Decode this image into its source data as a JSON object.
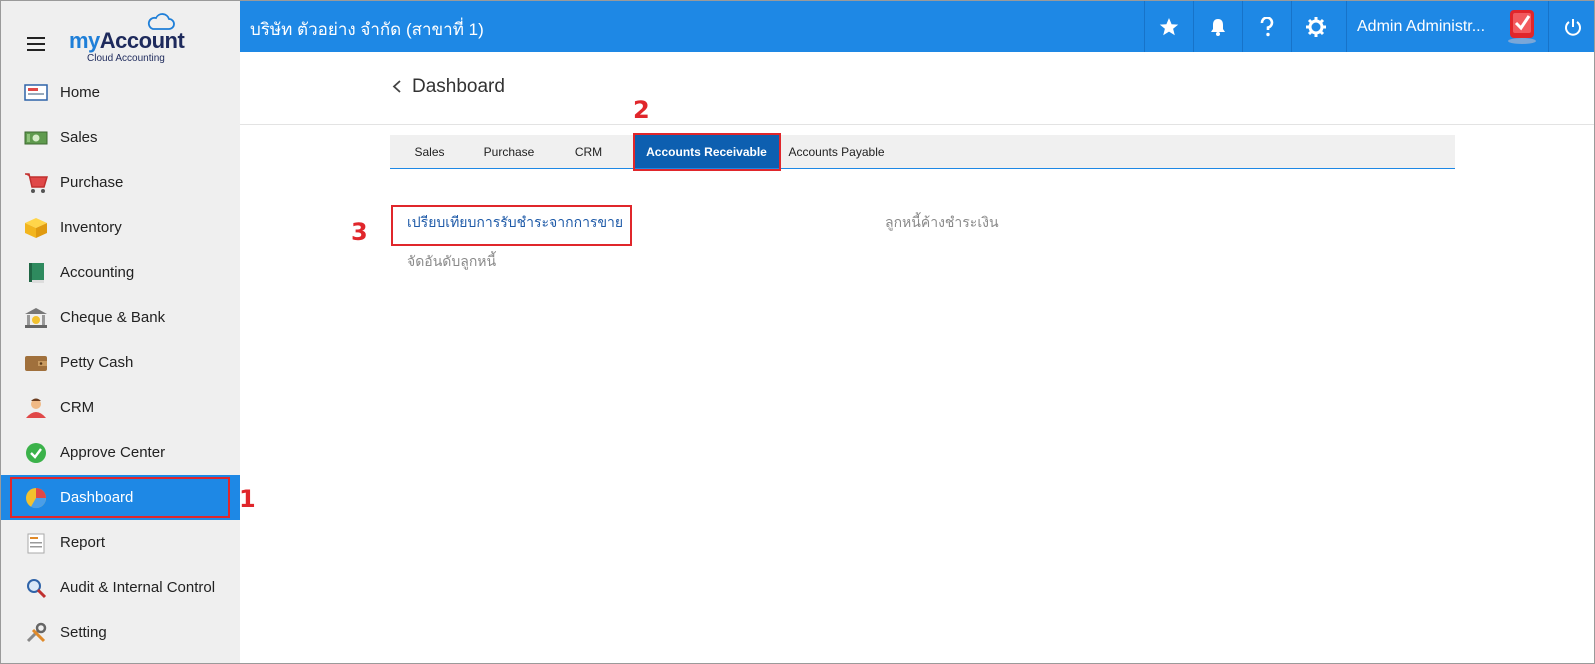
{
  "app": {
    "logo_main_a": "my",
    "logo_main_b": "Account",
    "logo_sub": "Cloud Accounting"
  },
  "topbar": {
    "company": "บริษัท ตัวอย่าง จำกัด (สาขาที่ 1)",
    "user": "Admin Administr..."
  },
  "sidebar": {
    "items": [
      {
        "label": "Home",
        "icon": "home-icon"
      },
      {
        "label": "Sales",
        "icon": "money-icon"
      },
      {
        "label": "Purchase",
        "icon": "cart-icon"
      },
      {
        "label": "Inventory",
        "icon": "box-icon"
      },
      {
        "label": "Accounting",
        "icon": "book-icon"
      },
      {
        "label": "Cheque & Bank",
        "icon": "bank-icon"
      },
      {
        "label": "Petty Cash",
        "icon": "wallet-icon"
      },
      {
        "label": "CRM",
        "icon": "person-icon"
      },
      {
        "label": "Approve Center",
        "icon": "check-circle-icon"
      },
      {
        "label": "Dashboard",
        "icon": "pie-chart-icon"
      },
      {
        "label": "Report",
        "icon": "report-icon"
      },
      {
        "label": "Audit & Internal Control",
        "icon": "magnifier-icon"
      },
      {
        "label": "Setting",
        "icon": "tools-icon"
      }
    ]
  },
  "page": {
    "title": "Dashboard"
  },
  "tabs": [
    {
      "label": "Sales"
    },
    {
      "label": "Purchase"
    },
    {
      "label": "CRM"
    },
    {
      "label": "Accounts Receivable"
    },
    {
      "label": "Accounts Payable"
    }
  ],
  "reports": {
    "compare_payment": "เปรียบเทียบการรับชำระจากการขาย",
    "rank_debtors": "จัดอันดับลูกหนี้",
    "outstanding_debtors": "ลูกหนี้ค้างชำระเงิน"
  },
  "annotations": {
    "a1": "1",
    "a2": "2",
    "a3": "3"
  },
  "colors": {
    "primary": "#1e88e5",
    "active_tab": "#0d5fb0",
    "highlight": "#e0262b"
  }
}
